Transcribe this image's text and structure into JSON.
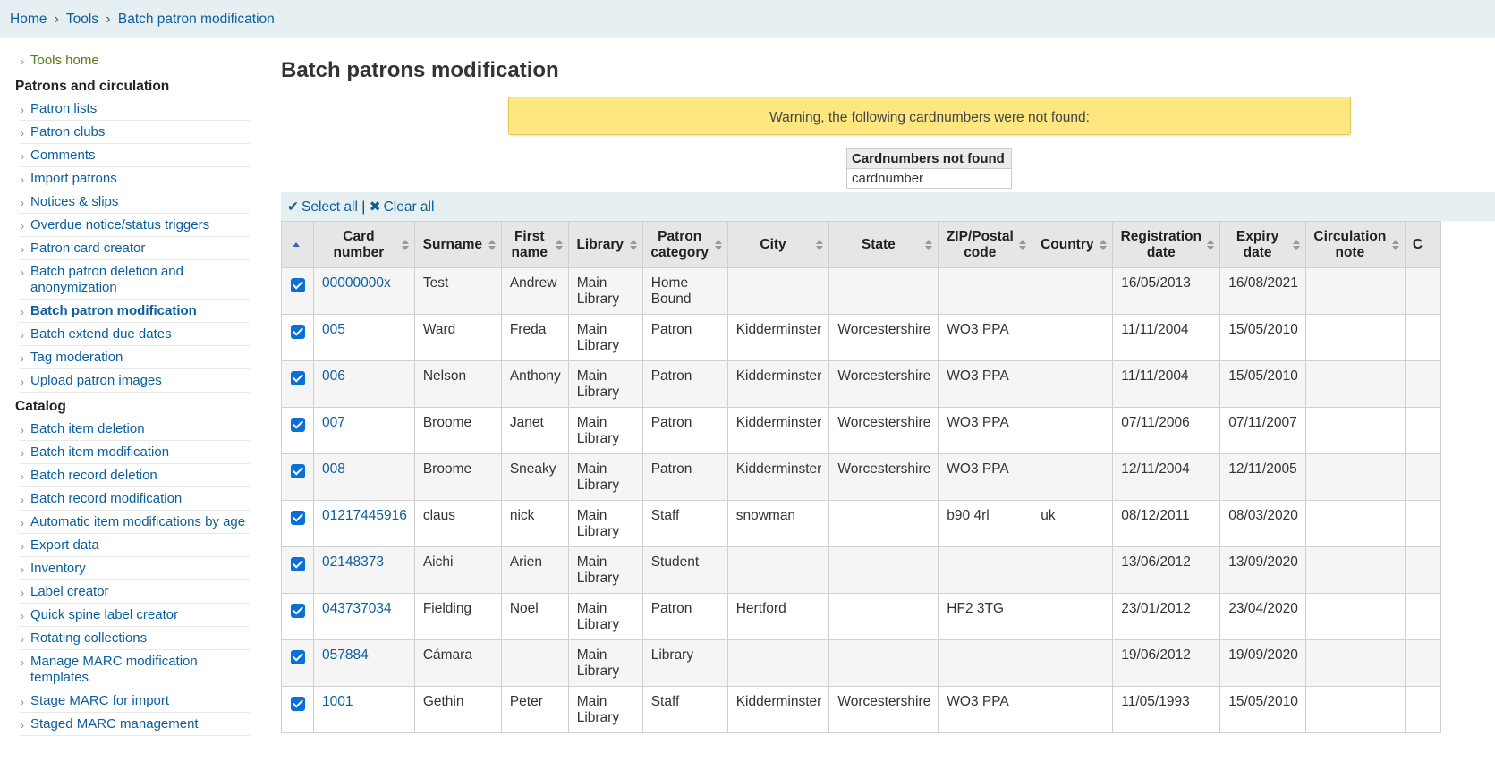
{
  "breadcrumb": {
    "home": "Home",
    "tools": "Tools",
    "current": "Batch patron modification",
    "sep": "›"
  },
  "sidebar": {
    "tools_home": "Tools home",
    "sections": [
      {
        "title": "Patrons and circulation",
        "items": [
          {
            "label": "Patron lists"
          },
          {
            "label": "Patron clubs"
          },
          {
            "label": "Comments"
          },
          {
            "label": "Import patrons"
          },
          {
            "label": "Notices & slips"
          },
          {
            "label": "Overdue notice/status triggers"
          },
          {
            "label": "Patron card creator"
          },
          {
            "label": "Batch patron deletion and anonymization"
          },
          {
            "label": "Batch patron modification",
            "active": true
          },
          {
            "label": "Batch extend due dates"
          },
          {
            "label": "Tag moderation"
          },
          {
            "label": "Upload patron images"
          }
        ]
      },
      {
        "title": "Catalog",
        "items": [
          {
            "label": "Batch item deletion"
          },
          {
            "label": "Batch item modification"
          },
          {
            "label": "Batch record deletion"
          },
          {
            "label": "Batch record modification"
          },
          {
            "label": "Automatic item modifications by age"
          },
          {
            "label": "Export data"
          },
          {
            "label": "Inventory"
          },
          {
            "label": "Label creator"
          },
          {
            "label": "Quick spine label creator"
          },
          {
            "label": "Rotating collections"
          },
          {
            "label": "Manage MARC modification templates"
          },
          {
            "label": "Stage MARC for import"
          },
          {
            "label": "Staged MARC management"
          }
        ]
      }
    ]
  },
  "main": {
    "title": "Batch patrons modification",
    "warning": "Warning, the following cardnumbers were not found:",
    "not_found_header": "Cardnumbers not found",
    "not_found_value": "cardnumber",
    "select_all": "Select all",
    "clear_all": "Clear all",
    "select_sep": "|"
  },
  "table": {
    "columns": [
      "",
      "Card number",
      "Surname",
      "First name",
      "Library",
      "Patron category",
      "City",
      "State",
      "ZIP/Postal code",
      "Country",
      "Registration date",
      "Expiry date",
      "Circulation note",
      "C"
    ],
    "rows": [
      {
        "card": "00000000x",
        "surname": "Test",
        "first": "Andrew",
        "library": "Main Library",
        "category": "Home Bound",
        "city": "",
        "state": "",
        "zip": "",
        "country": "",
        "reg": "16/05/2013",
        "exp": "16/08/2021",
        "note": ""
      },
      {
        "card": "005",
        "surname": "Ward",
        "first": "Freda",
        "library": "Main Library",
        "category": "Patron",
        "city": "Kidderminster",
        "state": "Worcestershire",
        "zip": "WO3 PPA",
        "country": "",
        "reg": "11/11/2004",
        "exp": "15/05/2010",
        "note": ""
      },
      {
        "card": "006",
        "surname": "Nelson",
        "first": "Anthony",
        "library": "Main Library",
        "category": "Patron",
        "city": "Kidderminster",
        "state": "Worcestershire",
        "zip": "WO3 PPA",
        "country": "",
        "reg": "11/11/2004",
        "exp": "15/05/2010",
        "note": ""
      },
      {
        "card": "007",
        "surname": "Broome",
        "first": "Janet",
        "library": "Main Library",
        "category": "Patron",
        "city": "Kidderminster",
        "state": "Worcestershire",
        "zip": "WO3 PPA",
        "country": "",
        "reg": "07/11/2006",
        "exp": "07/11/2007",
        "note": ""
      },
      {
        "card": "008",
        "surname": "Broome",
        "first": "Sneaky",
        "library": "Main Library",
        "category": "Patron",
        "city": "Kidderminster",
        "state": "Worcestershire",
        "zip": "WO3 PPA",
        "country": "",
        "reg": "12/11/2004",
        "exp": "12/11/2005",
        "note": ""
      },
      {
        "card": "01217445916",
        "surname": "claus",
        "first": "nick",
        "library": "Main Library",
        "category": "Staff",
        "city": "snowman",
        "state": "",
        "zip": "b90 4rl",
        "country": "uk",
        "reg": "08/12/2011",
        "exp": "08/03/2020",
        "note": ""
      },
      {
        "card": "02148373",
        "surname": "Aichi",
        "first": "Arien",
        "library": "Main Library",
        "category": "Student",
        "city": "",
        "state": "",
        "zip": "",
        "country": "",
        "reg": "13/06/2012",
        "exp": "13/09/2020",
        "note": ""
      },
      {
        "card": "043737034",
        "surname": "Fielding",
        "first": "Noel",
        "library": "Main Library",
        "category": "Patron",
        "city": "Hertford",
        "state": "",
        "zip": "HF2 3TG",
        "country": "",
        "reg": "23/01/2012",
        "exp": "23/04/2020",
        "note": ""
      },
      {
        "card": "057884",
        "surname": "Cámara",
        "first": "",
        "library": "Main Library",
        "category": "Library",
        "city": "",
        "state": "",
        "zip": "",
        "country": "",
        "reg": "19/06/2012",
        "exp": "19/09/2020",
        "note": ""
      },
      {
        "card": "1001",
        "surname": "Gethin",
        "first": "Peter",
        "library": "Main Library",
        "category": "Staff",
        "city": "Kidderminster",
        "state": "Worcestershire",
        "zip": "WO3 PPA",
        "country": "",
        "reg": "11/05/1993",
        "exp": "15/05/2010",
        "note": ""
      }
    ]
  }
}
